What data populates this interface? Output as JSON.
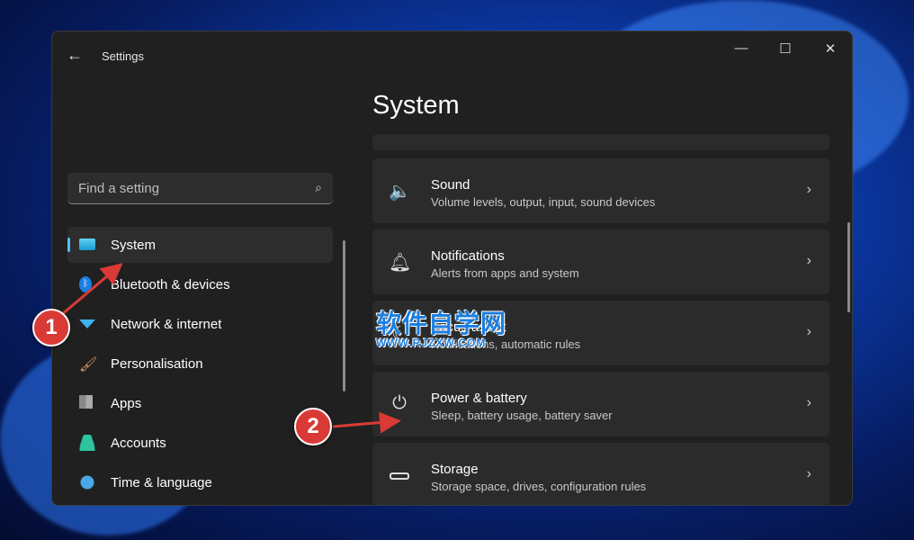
{
  "window": {
    "title": "Settings",
    "controls": [
      "minimize",
      "maximize",
      "close"
    ]
  },
  "search": {
    "placeholder": "Find a setting"
  },
  "nav": [
    {
      "label": "System",
      "icon": "monitor-icon",
      "selected": true
    },
    {
      "label": "Bluetooth & devices",
      "icon": "bluetooth-icon"
    },
    {
      "label": "Network & internet",
      "icon": "wifi-icon"
    },
    {
      "label": "Personalisation",
      "icon": "brush-icon"
    },
    {
      "label": "Apps",
      "icon": "apps-icon"
    },
    {
      "label": "Accounts",
      "icon": "person-icon"
    },
    {
      "label": "Time & language",
      "icon": "clock-globe-icon"
    }
  ],
  "page": {
    "title": "System"
  },
  "cards": [
    {
      "title": "Sound",
      "subtitle": "Volume levels, output, input, sound devices",
      "icon": "speaker-icon"
    },
    {
      "title": "Notifications",
      "subtitle": "Alerts from apps and system",
      "icon": "bell-icon"
    },
    {
      "title": "Focus assist",
      "subtitle": "Notifications, automatic rules",
      "icon": "moon-icon"
    },
    {
      "title": "Power & battery",
      "subtitle": "Sleep, battery usage, battery saver",
      "icon": "power-icon"
    },
    {
      "title": "Storage",
      "subtitle": "Storage space, drives, configuration rules",
      "icon": "drive-icon"
    }
  ],
  "annotations": {
    "badge1": "1",
    "badge2": "2"
  },
  "watermark": {
    "line1": "软件自学网",
    "line2": "WWW.RJZXW.COM"
  },
  "colors": {
    "accent": "#4cc2ff",
    "badge": "#d93a36"
  }
}
